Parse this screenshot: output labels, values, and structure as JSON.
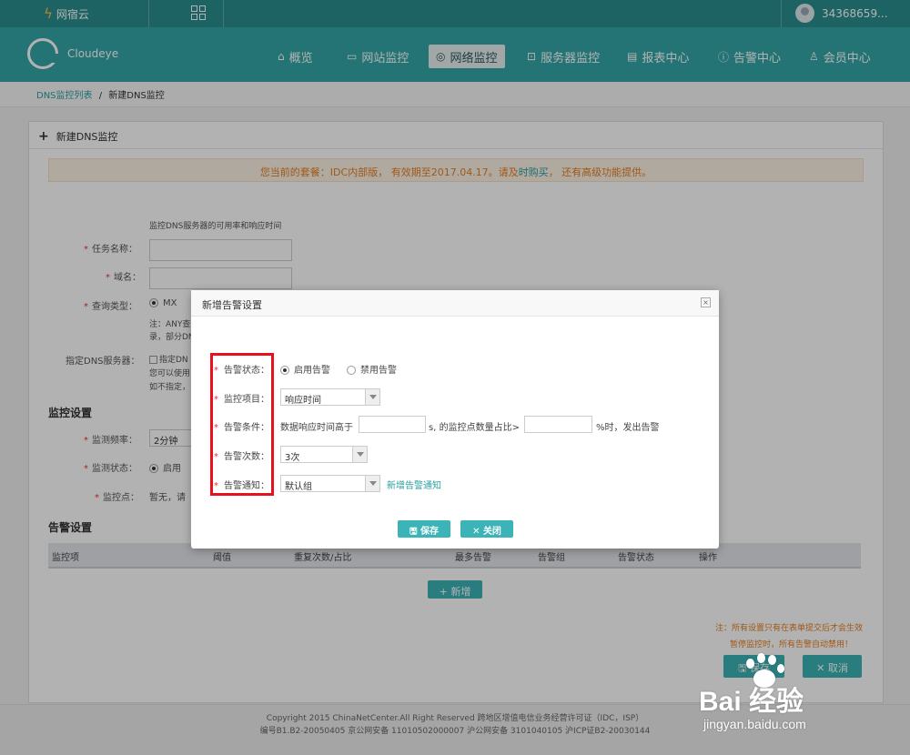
{
  "topbar": {
    "brand": "网宿云",
    "user": "34368659..."
  },
  "nav": {
    "logo": "Cloudeye",
    "items": [
      {
        "label": "概览",
        "icon": "home-icon"
      },
      {
        "label": "网站监控",
        "icon": "monitor-icon"
      },
      {
        "label": "网络监控",
        "icon": "globe-icon",
        "active": true
      },
      {
        "label": "服务器监控",
        "icon": "server-icon"
      },
      {
        "label": "报表中心",
        "icon": "report-icon"
      },
      {
        "label": "告警中心",
        "icon": "alert-icon"
      },
      {
        "label": "会员中心",
        "icon": "user-icon"
      }
    ]
  },
  "breadcrumb": {
    "parent": "DNS监控列表",
    "sep": "/",
    "current": "新建DNS监控"
  },
  "panel": {
    "title": "新建DNS监控",
    "notice_prefix": "您当前的套餐：IDC内部版， 有效期至2017.04.17。请及",
    "notice_link": "时购买",
    "notice_suffix": "， 还有高级功能提供。",
    "desc": "监控DNS服务器的可用率和响应时间",
    "task_label": "任务名称：",
    "domain_label": "域名：",
    "query_label": "查询类型：",
    "query_value": "MX",
    "query_note_1": "注：ANY查",
    "query_note_2": "录，部分DN",
    "dns_label": "指定DNS服务器：",
    "dns_check": "指定DN",
    "dns_note_1": "您可以使用",
    "dns_note_2": "如不指定，",
    "monitor_section": "监控设置",
    "freq_label": "监测频率：",
    "freq_value": "2分钟",
    "status_label": "监测状态：",
    "status_value": "启用",
    "point_label": "监控点：",
    "point_value": "暂无，请",
    "alarm_section": "告警设置",
    "table_headers": [
      "监控项",
      "阈值",
      "重复次数/占比",
      "最多告警",
      "告警组",
      "告警状态",
      "操作"
    ],
    "add_label": "新增",
    "note_1": "注：所有设置只有在表单提交后才会生效",
    "note_2": "暂停监控时，所有告警自动禁用！",
    "save_label": "保存",
    "cancel_label": "取消"
  },
  "footer": {
    "line1": "Copyright 2015 ChinaNetCenter.All Right Reserved 跨地区增值电信业务经营许可证（IDC，ISP）",
    "line2": "编号B1.B2-20050405 京公网安备 11010502000007 沪公网安备 3101040105 沪ICP证B2-20030144"
  },
  "modal": {
    "title": "新增告警设置",
    "close": "×",
    "status_label": "告警状态：",
    "status_on": "启用告警",
    "status_off": "禁用告警",
    "item_label": "监控项目：",
    "item_value": "响应时间",
    "cond_label": "告警条件：",
    "cond_text1": "数据响应时间高于",
    "cond_text2": "s, 的监控点数量占比>",
    "cond_text3": "%时，发出告警",
    "count_label": "告警次数：",
    "count_value": "3次",
    "notify_label": "告警通知：",
    "notify_value": "默认组",
    "notify_link": "新增告警通知",
    "save": "保存",
    "close_btn": "关闭"
  },
  "watermark": {
    "main": "Bai 经验",
    "sub": "jingyan.baidu.com"
  },
  "colors": {
    "nav": "#35a7a8",
    "topbar": "#2b8f90",
    "accent": "#3bb4b7",
    "highlight": "#e8101c",
    "warning": "#e67e22"
  }
}
